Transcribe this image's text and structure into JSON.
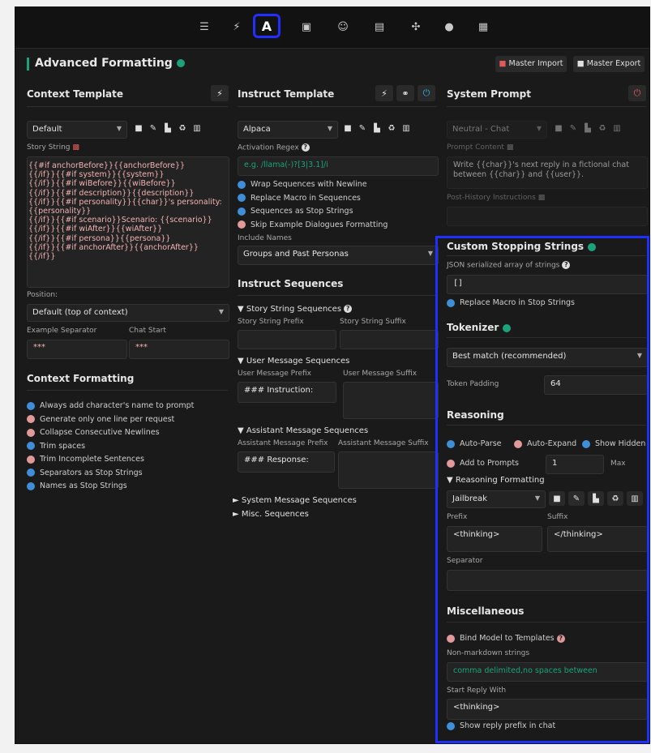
{
  "topbar": {
    "icons": [
      "sliders-icon",
      "plug-icon",
      "a-icon",
      "book-icon",
      "persona-icon",
      "image-icon",
      "extensions-icon",
      "smiley-icon",
      "id-card-icon"
    ],
    "active_label": "A"
  },
  "header": {
    "title": "Advanced Formatting",
    "master_import": "Master Import",
    "master_export": "Master Export"
  },
  "context_template": {
    "title": "Context Template",
    "preset": "Default",
    "story_string_label": "Story String",
    "story_string": "{{#if anchorBefore}}{{anchorBefore}}\n{{/if}}{{#if system}}{{system}}\n{{/if}}{{#if wiBefore}}{{wiBefore}}\n{{/if}}{{#if description}}{{description}}\n{{/if}}{{#if personality}}{{char}}'s personality:\n{{personality}}\n{{/if}}{{#if scenario}}Scenario: {{scenario}}\n{{/if}}{{#if wiAfter}}{{wiAfter}}\n{{/if}}{{#if persona}}{{persona}}\n{{/if}}{{#if anchorAfter}}{{anchorAfter}}\n{{/if}}",
    "position_label": "Position:",
    "position_value": "Default (top of context)",
    "example_separator_label": "Example Separator",
    "chat_start_label": "Chat Start",
    "example_separator_value": "***",
    "chat_start_value": "***"
  },
  "context_formatting": {
    "title": "Context Formatting",
    "items": [
      {
        "label": "Always add character's name to prompt",
        "on": true
      },
      {
        "label": "Generate only one line per request",
        "on": false
      },
      {
        "label": "Collapse Consecutive Newlines",
        "on": false
      },
      {
        "label": "Trim spaces",
        "on": true
      },
      {
        "label": "Trim Incomplete Sentences",
        "on": false
      },
      {
        "label": "Separators as Stop Strings",
        "on": true
      },
      {
        "label": "Names as Stop Strings",
        "on": true
      }
    ]
  },
  "instruct_template": {
    "title": "Instruct Template",
    "preset": "Alpaca",
    "activation_regex_label": "Activation Regex",
    "activation_regex_placeholder": "e.g. /llama(-)?[3|3.1]/i",
    "options": [
      {
        "label": "Wrap Sequences with Newline",
        "on": true
      },
      {
        "label": "Replace Macro in Sequences",
        "on": true
      },
      {
        "label": "Sequences as Stop Strings",
        "on": true
      },
      {
        "label": "Skip Example Dialogues Formatting",
        "on": false
      }
    ],
    "include_names_label": "Include Names",
    "include_names_value": "Groups and Past Personas"
  },
  "instruct_sequences": {
    "title": "Instruct Sequences",
    "story_string_sequences": "▼ Story String Sequences",
    "story_string_prefix": "Story String Prefix",
    "story_string_suffix": "Story String Suffix",
    "user_message_sequences": "▼ User Message Sequences",
    "user_message_prefix": "User Message Prefix",
    "user_message_suffix": "User Message Suffix",
    "user_prefix_value": "### Instruction:",
    "assistant_message_sequences": "▼ Assistant Message Sequences",
    "assistant_message_prefix": "Assistant Message Prefix",
    "assistant_message_suffix": "Assistant Message Suffix",
    "assistant_prefix_value": "### Response:",
    "system_message_sequences": "► System Message Sequences",
    "misc_sequences": "► Misc. Sequences"
  },
  "system_prompt": {
    "title": "System Prompt",
    "preset": "Neutral - Chat",
    "prompt_content_label": "Prompt Content",
    "prompt_content": "Write {{char}}'s next reply in a fictional chat between {{char}} and {{user}}.",
    "post_history_label": "Post-History Instructions"
  },
  "stopping": {
    "title": "Custom Stopping Strings",
    "json_label": "JSON serialized array of strings",
    "json_value": "[]",
    "replace_macro": "Replace Macro in Stop Strings"
  },
  "tokenizer": {
    "title": "Tokenizer",
    "value": "Best match (recommended)",
    "token_padding_label": "Token Padding",
    "token_padding_value": "64"
  },
  "reasoning": {
    "title": "Reasoning",
    "auto_parse": "Auto-Parse",
    "auto_expand": "Auto-Expand",
    "show_hidden": "Show Hidden",
    "add_to_prompts": "Add to Prompts",
    "max_value": "1",
    "max_label": "Max",
    "formatting_label": "▼ Reasoning Formatting",
    "preset": "Jailbreak",
    "prefix_label": "Prefix",
    "suffix_label": "Suffix",
    "prefix_value": "<thinking>",
    "suffix_value": "</thinking>",
    "separator_label": "Separator"
  },
  "misc": {
    "title": "Miscellaneous",
    "bind_model": "Bind Model to Templates",
    "non_markdown_label": "Non-markdown strings",
    "non_markdown_placeholder": "comma delimited,no spaces between",
    "start_reply_label": "Start Reply With",
    "start_reply_value": "<thinking>",
    "show_reply_prefix": "Show reply prefix in chat"
  },
  "colors": {
    "accent": "#1f2fff",
    "teal": "#1aa37a",
    "check_on": "#3f8fd8",
    "check_off": "#e09a9a"
  }
}
